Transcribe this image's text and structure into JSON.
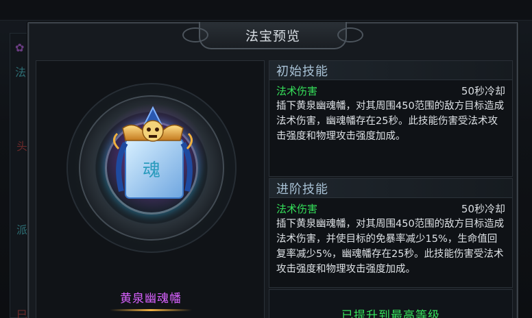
{
  "background": {
    "chars": [
      "法",
      "头",
      "派",
      "巳"
    ]
  },
  "modal": {
    "title": "法宝预览",
    "item": {
      "name": "黄泉幽魂幡",
      "icon": "soul-banner-icon",
      "banner_glyph": "魂"
    },
    "basic_skill": {
      "header": "初始技能",
      "name": "法术伤害",
      "cooldown": "50秒冷却",
      "description": "插下黄泉幽魂幡，对其周围450范围的敌方目标造成法术伤害，幽魂幡存在25秒。此技能伤害受法术攻击强度和物理攻击强度加成。"
    },
    "advanced_skill": {
      "header": "进阶技能",
      "name": "法术伤害",
      "cooldown": "50秒冷却",
      "description": "插下黄泉幽魂幡，对其周围450范围的敌方目标造成法术伤害，并使目标的免暴率减少15%，生命值回复率减少5%，幽魂幡存在25秒。此技能伤害受法术攻击强度和物理攻击强度加成。"
    },
    "status_text": "已提升到最高等级"
  },
  "colors": {
    "skill_name": "#35e05a",
    "item_name": "#d861ff",
    "header_text": "#a9c2d6"
  }
}
